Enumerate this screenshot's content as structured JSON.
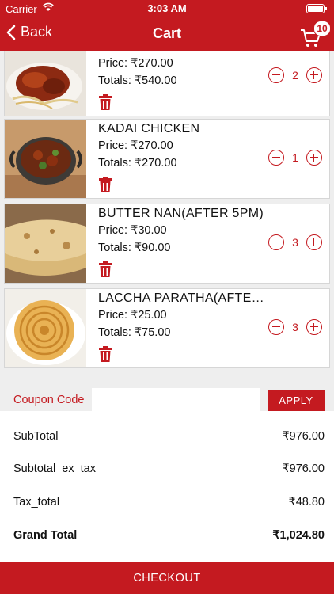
{
  "status_bar": {
    "carrier": "Carrier",
    "time": "3:03 AM"
  },
  "nav": {
    "back_label": "Back",
    "title": "Cart",
    "cart_count": "10"
  },
  "colors": {
    "brand": "#c41a20"
  },
  "items": [
    {
      "name": "",
      "price": "Price: ₹270.00",
      "total": "Totals: ₹540.00",
      "qty": "2",
      "image": "roast-chicken-plate"
    },
    {
      "name": "KADAI CHICKEN",
      "price": "Price: ₹270.00",
      "total": "Totals: ₹270.00",
      "qty": "1",
      "image": "kadai-chicken-bowl"
    },
    {
      "name": "BUTTER NAN(AFTER 5PM)",
      "price": "Price: ₹30.00",
      "total": "Totals: ₹90.00",
      "qty": "3",
      "image": "butter-nan"
    },
    {
      "name": "LACCHA PARATHA(AFTE…",
      "price": "Price: ₹25.00",
      "total": "Totals: ₹75.00",
      "qty": "3",
      "image": "laccha-paratha"
    }
  ],
  "coupon": {
    "label": "Coupon Code",
    "value": "",
    "placeholder": "",
    "apply_label": "APPLY"
  },
  "summary": {
    "subtotal_label": "SubTotal",
    "subtotal_value": "₹976.00",
    "subtotal_ex_tax_label": "Subtotal_ex_tax",
    "subtotal_ex_tax_value": "₹976.00",
    "tax_total_label": "Tax_total",
    "tax_total_value": "₹48.80",
    "grand_total_label": "Grand Total",
    "grand_total_value": "₹1,024.80"
  },
  "checkout_label": "CHECKOUT"
}
